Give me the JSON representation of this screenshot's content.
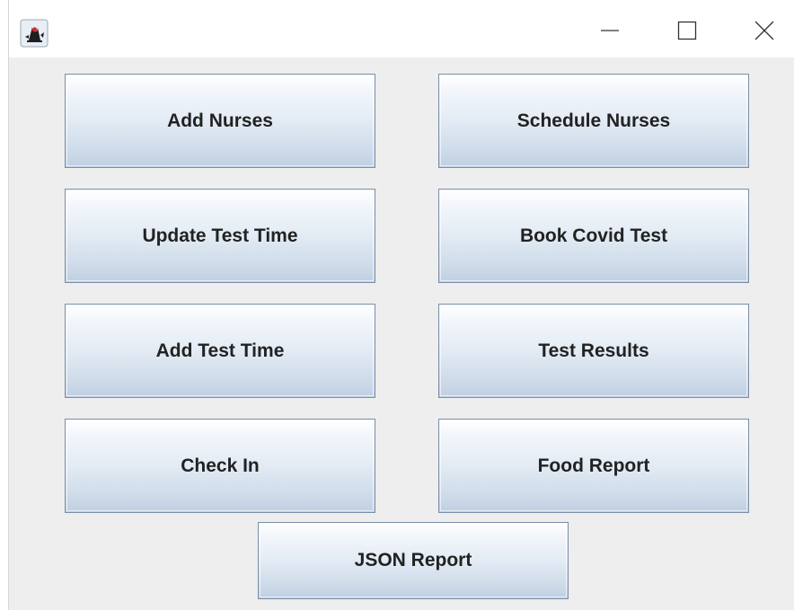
{
  "window": {
    "icon": "java-duke-icon",
    "controls": {
      "minimize": "minimize-icon",
      "maximize": "maximize-icon",
      "close": "close-icon"
    }
  },
  "buttons": {
    "add_nurses": "Add Nurses",
    "schedule_nurses": "Schedule Nurses",
    "update_test_time": "Update Test Time",
    "book_covid_test": "Book Covid Test",
    "add_test_time": "Add Test Time",
    "test_results": "Test Results",
    "check_in": "Check In",
    "food_report": "Food Report",
    "json_report": "JSON Report"
  },
  "colors": {
    "panel_background": "#eeeeee",
    "button_border": "#7a8ea8",
    "button_gradient_bottom": "#c0d0e2",
    "text": "#222222"
  }
}
